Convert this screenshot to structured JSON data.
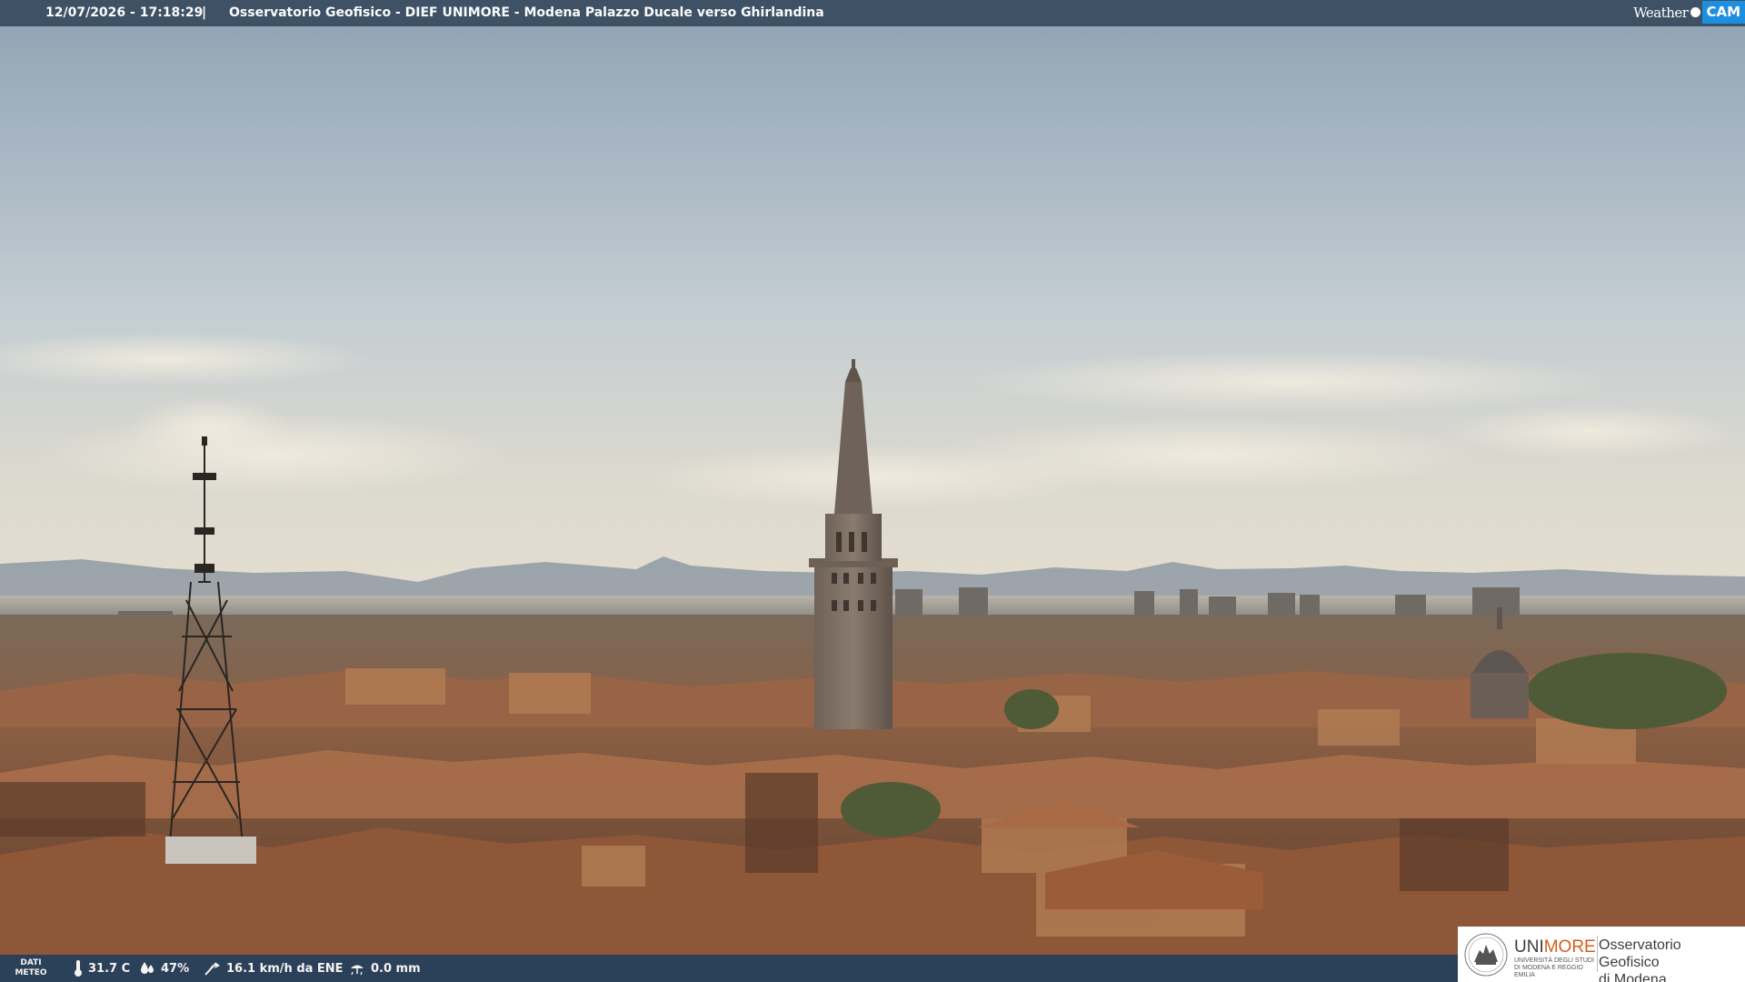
{
  "header": {
    "timestamp": "12/07/2026 - 17:18:29",
    "separator": "|",
    "title": "Osservatorio Geofisico - DIEF UNIMORE - Modena Palazzo Ducale verso Ghirlandina"
  },
  "brand": {
    "word": "Weather",
    "cam": "CAM",
    "accent_color": "#1c8fe0"
  },
  "meteo": {
    "label_line1": "DATI",
    "label_line2": "METEO",
    "temperature": "31.7 C",
    "humidity": "47%",
    "wind": "16.1 km/h da ENE",
    "rain": "0.0 mm",
    "icons": [
      "thermometer-icon",
      "humidity-icon",
      "wind-icon",
      "rain-gauge-icon"
    ]
  },
  "logo": {
    "uni_prefix": "UNI",
    "uni_suffix": "MORE",
    "uni_sub": "UNIVERSITÀ DEGLI STUDI DI MODENA E REGGIO EMILIA",
    "observatory_line1": "Osservatorio Geofisico",
    "observatory_line2": "di Modena",
    "accent_color": "#d15e1c"
  }
}
